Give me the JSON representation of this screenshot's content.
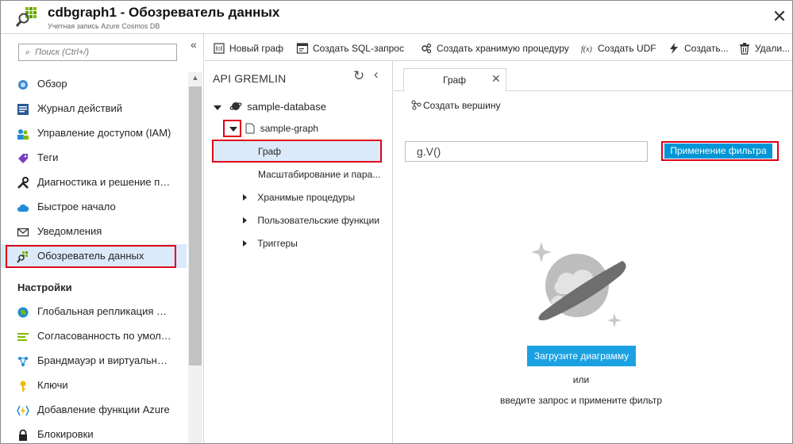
{
  "window": {
    "title": "cdbgraph1 - Обозреватель данных",
    "subtitle": "Учетная запись Azure Cosmos DB",
    "close_symbol": "✕"
  },
  "search": {
    "placeholder": "Поиск (Ctrl+/)",
    "collapse_symbol": "«"
  },
  "sidebar": {
    "items": [
      {
        "label": "Обзор",
        "icon": "cosmos-overview-icon"
      },
      {
        "label": "Журнал действий",
        "icon": "activity-log-icon"
      },
      {
        "label": "Управление доступом (IAM)",
        "icon": "iam-icon"
      },
      {
        "label": "Теги",
        "icon": "tag-icon"
      },
      {
        "label": "Диагностика и решение пр...",
        "icon": "wrench-icon"
      },
      {
        "label": "Быстрое начало",
        "icon": "cloud-icon"
      },
      {
        "label": "Уведомления",
        "icon": "mail-icon"
      },
      {
        "label": "Обозреватель данных",
        "icon": "data-explorer-icon",
        "selected": true
      }
    ],
    "section_settings": "Настройки",
    "settings_items": [
      {
        "label": "Глобальная репликация да...",
        "icon": "globe-icon"
      },
      {
        "label": "Согласованность по умолч...",
        "icon": "consistency-icon"
      },
      {
        "label": "Брандмауэр и виртуальные...",
        "icon": "firewall-icon"
      },
      {
        "label": "Ключи",
        "icon": "key-icon"
      },
      {
        "label": "Добавление функции Azure",
        "icon": "azure-function-icon"
      },
      {
        "label": "Блокировки",
        "icon": "lock-icon"
      }
    ]
  },
  "toolbar": {
    "new_graph": "Новый граф",
    "new_sql": "Создать SQL-запрос",
    "new_sproc": "Создать хранимую процедуру",
    "new_udf": "Создать UDF",
    "new_trigger": "Создать...",
    "delete": "Удали..."
  },
  "tree": {
    "header": "API GREMLIN",
    "database": "sample-database",
    "collection": "sample-graph",
    "graph": "Граф",
    "scale": "Масштабирование и пара...",
    "sprocs": "Хранимые процедуры",
    "udfs": "Пользовательские функции",
    "triggers": "Триггеры"
  },
  "main": {
    "tab_label": "Граф",
    "tab_close": "✕",
    "new_vertex": "Создать вершину",
    "query_value": "g.V()",
    "apply_filter": "Применение фильтра",
    "load_graph": "Загрузите диаграмму",
    "or": "или",
    "hint": "введите запрос и примените фильтр"
  },
  "colors": {
    "accent": "#0096d6",
    "load_button": "#1ba1e2",
    "selection": "#dbeafa",
    "annotation": "#e1001a"
  }
}
